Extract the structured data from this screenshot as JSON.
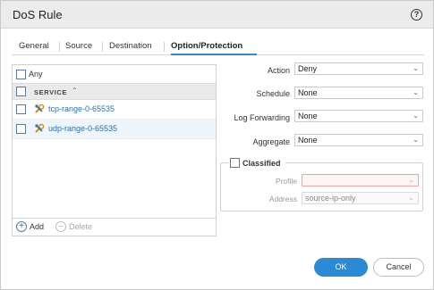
{
  "dialog": {
    "title": "DoS Rule",
    "help_icon": "help-icon"
  },
  "tabs": [
    {
      "label": "General",
      "active": false
    },
    {
      "label": "Source",
      "active": false
    },
    {
      "label": "Destination",
      "active": false
    },
    {
      "label": "Option/Protection",
      "active": true
    }
  ],
  "services": {
    "any_label": "Any",
    "any_checked": false,
    "column_header": "SERVICE",
    "sort_icon": "sort-ascending-icon",
    "rows": [
      {
        "label": "tcp-range-0-65535",
        "icon": "service-icon",
        "selected": false
      },
      {
        "label": "udp-range-0-65535",
        "icon": "service-icon",
        "selected": true
      }
    ],
    "add_label": "Add",
    "delete_label": "Delete"
  },
  "options": {
    "action": {
      "label": "Action",
      "value": "Deny"
    },
    "schedule": {
      "label": "Schedule",
      "value": "None"
    },
    "log_forwarding": {
      "label": "Log Forwarding",
      "value": "None"
    },
    "aggregate": {
      "label": "Aggregate",
      "value": "None"
    }
  },
  "classified": {
    "label": "Classified",
    "checked": false,
    "profile": {
      "label": "Profile",
      "value": ""
    },
    "address": {
      "label": "Address",
      "value": "source-ip-only"
    }
  },
  "buttons": {
    "ok": "OK",
    "cancel": "Cancel"
  },
  "colors": {
    "accent": "#2b8ad6",
    "link": "#2a6fb0",
    "error_border": "#e8a8a0"
  }
}
